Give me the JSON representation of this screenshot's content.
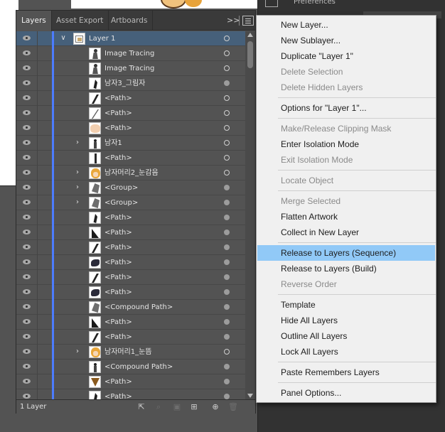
{
  "panel": {
    "tabs": [
      "Layers",
      "Asset Export",
      "Artboards"
    ],
    "more_glyph": ">>",
    "footer_label": "1 Layer"
  },
  "right_strip": {
    "title": "Preferences"
  },
  "colors": {
    "accent": "#4c7cff",
    "selected_row": "#46607a",
    "menu_highlight": "#91c9f7"
  },
  "layers": [
    {
      "label": "Layer 1",
      "level": 0,
      "expanded": true,
      "selected": true,
      "thumb": "layer",
      "target": "open"
    },
    {
      "label": "Image Tracing",
      "level": 1,
      "thumb": "figure",
      "target": "open"
    },
    {
      "label": "Image Tracing",
      "level": 1,
      "thumb": "figure",
      "target": "open"
    },
    {
      "label": "남자3_그림자",
      "level": 1,
      "thumb": "dark-shape",
      "target": "filled"
    },
    {
      "label": "<Path>",
      "level": 1,
      "thumb": "slash",
      "target": "open"
    },
    {
      "label": "<Path>",
      "level": 1,
      "thumb": "thin-slash",
      "target": "open"
    },
    {
      "label": "<Path>",
      "level": 1,
      "thumb": "skin",
      "target": "open"
    },
    {
      "label": "남자1",
      "level": 1,
      "expandable": true,
      "thumb": "figure-small",
      "target": "open"
    },
    {
      "label": "<Path>",
      "level": 1,
      "thumb": "tall-dark",
      "target": "open"
    },
    {
      "label": "남자머리2_눈감음",
      "level": 1,
      "expandable": true,
      "thumb": "hair",
      "target": "open"
    },
    {
      "label": "<Group>",
      "level": 1,
      "expandable": true,
      "thumb": "gray-shape",
      "target": "filled"
    },
    {
      "label": "<Group>",
      "level": 1,
      "expandable": true,
      "thumb": "gray-shape",
      "target": "filled"
    },
    {
      "label": "<Path>",
      "level": 1,
      "thumb": "dark-shape",
      "target": "filled"
    },
    {
      "label": "<Path>",
      "level": 1,
      "thumb": "wedge",
      "target": "filled"
    },
    {
      "label": "<Path>",
      "level": 1,
      "thumb": "slash",
      "target": "filled"
    },
    {
      "label": "<Path>",
      "level": 1,
      "thumb": "blob",
      "target": "filled"
    },
    {
      "label": "<Path>",
      "level": 1,
      "thumb": "slash",
      "target": "filled"
    },
    {
      "label": "<Path>",
      "level": 1,
      "thumb": "blob",
      "target": "filled"
    },
    {
      "label": "<Compound Path>",
      "level": 1,
      "thumb": "gray-shape",
      "target": "filled"
    },
    {
      "label": "<Path>",
      "level": 1,
      "thumb": "wedge",
      "target": "filled"
    },
    {
      "label": "<Path>",
      "level": 1,
      "thumb": "slash",
      "target": "filled"
    },
    {
      "label": "남자머리1_눈뜸",
      "level": 1,
      "expandable": true,
      "thumb": "hair",
      "target": "open"
    },
    {
      "label": "<Compound Path>",
      "level": 1,
      "thumb": "figure-small",
      "target": "filled"
    },
    {
      "label": "<Path>",
      "level": 1,
      "thumb": "brown",
      "target": "filled"
    },
    {
      "label": "<Path>",
      "level": 1,
      "thumb": "dark-shape",
      "target": "filled"
    }
  ],
  "menu": {
    "items": [
      {
        "label": "New Layer...",
        "enabled": true
      },
      {
        "label": "New Sublayer...",
        "enabled": true
      },
      {
        "label": "Duplicate \"Layer 1\"",
        "enabled": true
      },
      {
        "label": "Delete Selection",
        "enabled": false
      },
      {
        "label": "Delete Hidden Layers",
        "enabled": false
      },
      {
        "sep": true
      },
      {
        "label": "Options for \"Layer 1\"...",
        "enabled": true
      },
      {
        "sep": true
      },
      {
        "label": "Make/Release Clipping Mask",
        "enabled": false
      },
      {
        "label": "Enter Isolation Mode",
        "enabled": true
      },
      {
        "label": "Exit Isolation Mode",
        "enabled": false
      },
      {
        "sep": true
      },
      {
        "label": "Locate Object",
        "enabled": false
      },
      {
        "sep": true
      },
      {
        "label": "Merge Selected",
        "enabled": false
      },
      {
        "label": "Flatten Artwork",
        "enabled": true
      },
      {
        "label": "Collect in New Layer",
        "enabled": true
      },
      {
        "sep": true
      },
      {
        "label": "Release to Layers (Sequence)",
        "enabled": true,
        "highlighted": true
      },
      {
        "label": "Release to Layers (Build)",
        "enabled": true
      },
      {
        "label": "Reverse Order",
        "enabled": false
      },
      {
        "sep": true
      },
      {
        "label": "Template",
        "enabled": true
      },
      {
        "label": "Hide All Layers",
        "enabled": true
      },
      {
        "label": "Outline All Layers",
        "enabled": true
      },
      {
        "label": "Lock All Layers",
        "enabled": true
      },
      {
        "sep": true
      },
      {
        "label": "Paste Remembers Layers",
        "enabled": true
      },
      {
        "sep": true
      },
      {
        "label": "Panel Options...",
        "enabled": true
      }
    ]
  },
  "footer_icons": [
    {
      "name": "export-icon",
      "glyph": "⇱",
      "enabled": true
    },
    {
      "name": "locate-object-icon",
      "glyph": "⌕",
      "enabled": false
    },
    {
      "name": "clipping-mask-icon",
      "glyph": "▣",
      "enabled": false
    },
    {
      "name": "new-sublayer-icon",
      "glyph": "⊞",
      "enabled": true
    },
    {
      "name": "new-layer-icon",
      "glyph": "⊕",
      "enabled": true
    },
    {
      "name": "delete-icon",
      "glyph": "🗑",
      "enabled": false
    }
  ]
}
